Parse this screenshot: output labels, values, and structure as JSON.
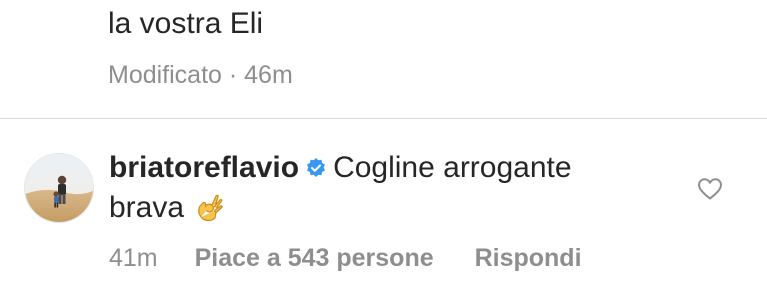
{
  "previous_comment": {
    "text_line": "la vostra Eli",
    "meta": "Modificato · 46m"
  },
  "reply": {
    "username": "briatoreflavio",
    "verified_icon": "verified-badge-icon",
    "text_line1": "Cogline arrogante",
    "text_line2": "brava",
    "emoji": "ok-hand-icon",
    "like_icon": "heart-outline-icon",
    "time": "41m",
    "likes_label": "Piace a 543 persone",
    "reply_label": "Rispondi"
  },
  "colors": {
    "text": "#262626",
    "secondary": "#8e8e8e",
    "verified": "#3897f0",
    "divider": "#dbdbdb"
  }
}
